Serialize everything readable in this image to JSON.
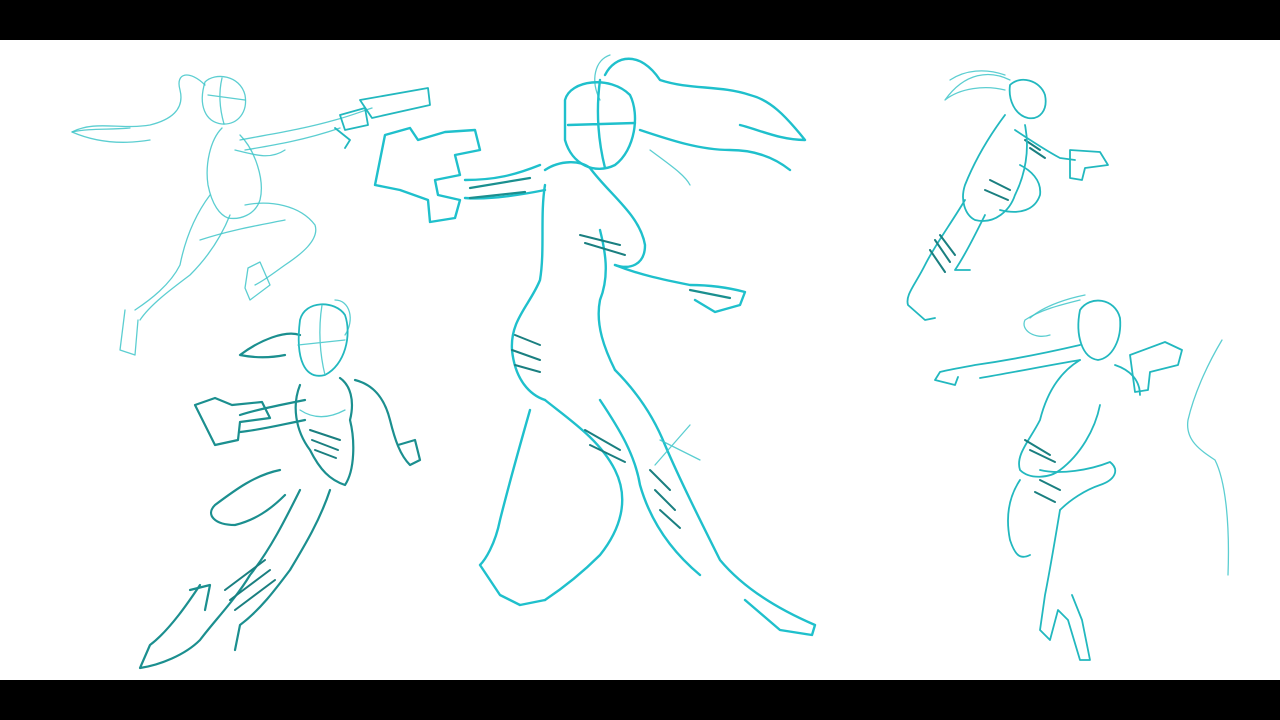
{
  "scene": {
    "letterbox_color": "#000000",
    "paper_color": "#ffffff",
    "ink_colors": {
      "light": "#3fc6c9",
      "bright": "#1fc0cc",
      "dark": "#1b8f8f"
    },
    "sketches": [
      {
        "name": "leaping-figure-top-left"
      },
      {
        "name": "falling-figure-bottom-left"
      },
      {
        "name": "running-figure-center"
      },
      {
        "name": "running-figure-top-right"
      },
      {
        "name": "kneeling-figure-bottom-right"
      }
    ]
  }
}
